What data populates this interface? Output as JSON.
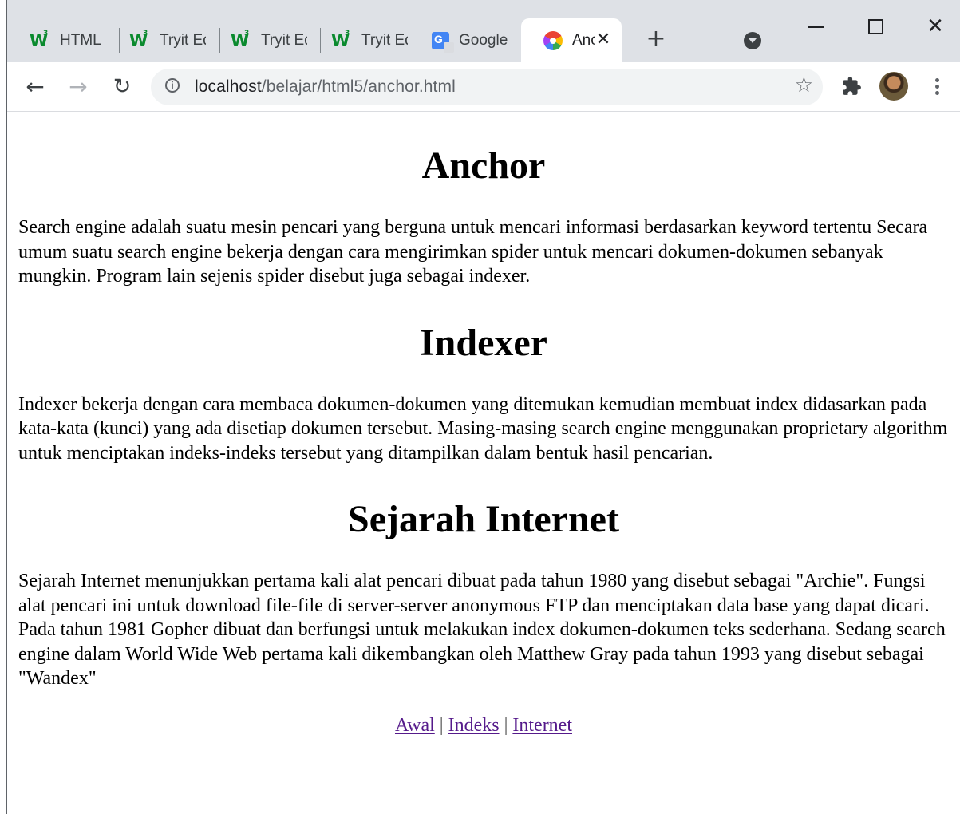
{
  "browser": {
    "tabs": [
      {
        "label": "HTML",
        "icon": "w3schools-icon"
      },
      {
        "label": "Tryit Ed",
        "icon": "w3schools-icon"
      },
      {
        "label": "Tryit Ed",
        "icon": "w3schools-icon"
      },
      {
        "label": "Tryit Ed",
        "icon": "w3schools-icon"
      },
      {
        "label": "Google",
        "icon": "google-translate-icon"
      },
      {
        "label": "Anc",
        "icon": "pinwheel-icon",
        "active": true
      }
    ],
    "new_tab": "+",
    "close_tab": "✕",
    "window_close": "✕",
    "url_host": "localhost",
    "url_path": "/belajar/html5/anchor.html"
  },
  "page": {
    "sections": [
      {
        "heading": "Anchor",
        "text": "Search engine adalah suatu mesin pencari yang berguna untuk mencari informasi berdasarkan keyword tertentu Secara umum suatu search engine bekerja dengan cara mengirimkan spider untuk mencari dokumen-dokumen sebanyak mungkin. Program lain sejenis spider disebut juga sebagai indexer."
      },
      {
        "heading": "Indexer",
        "text": "Indexer bekerja dengan cara membaca dokumen-dokumen yang ditemukan kemudian membuat index didasarkan pada kata-kata (kunci) yang ada disetiap dokumen tersebut. Masing-masing search engine menggunakan proprietary algorithm untuk menciptakan indeks-indeks tersebut yang ditampilkan dalam bentuk hasil pencarian."
      },
      {
        "heading": "Sejarah Internet",
        "text": "Sejarah Internet menunjukkan pertama kali alat pencari dibuat pada tahun 1980 yang disebut sebagai \"Archie\". Fungsi alat pencari ini untuk download file-file di server-server anonymous FTP dan menciptakan data base yang dapat dicari. Pada tahun 1981 Gopher dibuat dan berfungsi untuk melakukan index dokumen-dokumen teks sederhana. Sedang search engine dalam World Wide Web pertama kali dikembangkan oleh Matthew Gray pada tahun 1993 yang disebut sebagai \"Wandex\""
      }
    ],
    "links": [
      "Awal",
      "Indeks",
      "Internet"
    ],
    "link_separator": "|"
  },
  "colors": {
    "tabstrip": "#dee1e6",
    "link_visited": "#551a8b"
  }
}
